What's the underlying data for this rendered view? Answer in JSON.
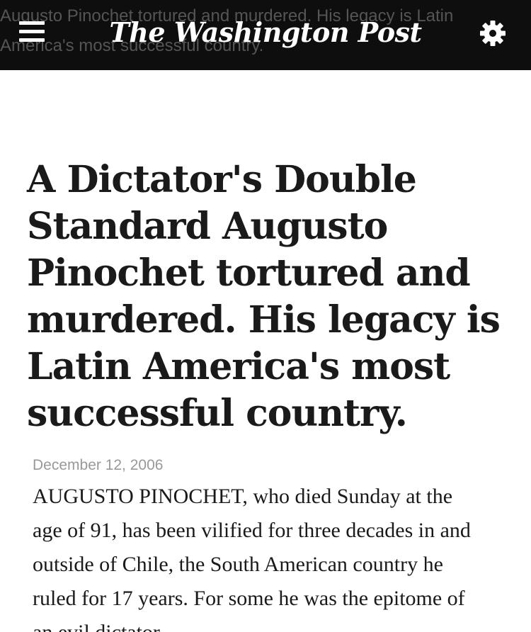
{
  "header": {
    "background_title": "Augusto Pinochet tortured and murdered. His legacy is Latin America's most successful country.",
    "logo_text": "The Washington Post",
    "menu_icon": "hamburger-menu-icon",
    "settings_icon": "gear-icon"
  },
  "article": {
    "headline": "A Dictator's Double Standard Augusto Pinochet tortured and murdered. His legacy is Latin America's most successful country.",
    "date": "December 12, 2006",
    "body": "AUGUSTO PINOCHET, who died Sunday at the age of 91, has been vilified for three decades in and outside of Chile, the South American country he ruled for 17 years. For some he was the epitome of an evil dictator"
  },
  "colors": {
    "topbar": "#0e0e0e",
    "text": "#1a1a1a",
    "dateline": "#999999"
  }
}
